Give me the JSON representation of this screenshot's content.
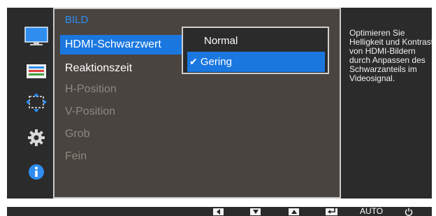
{
  "menu": {
    "title": "BILD",
    "items": [
      {
        "label": "HDMI-Schwarzwert",
        "state": "active"
      },
      {
        "label": "Reaktionszeit",
        "state": "normal"
      },
      {
        "label": "H-Position",
        "state": "disabled"
      },
      {
        "label": "V-Position",
        "state": "disabled"
      },
      {
        "label": "Grob",
        "state": "disabled"
      },
      {
        "label": "Fein",
        "state": "disabled"
      }
    ]
  },
  "submenu": {
    "options": [
      {
        "label": "Normal",
        "selected": false
      },
      {
        "label": "Gering",
        "selected": true
      }
    ],
    "check_glyph": "✔"
  },
  "description": "Optimieren Sie\nHelligkeit und Kontrast\nvon HDMI-Bildern\ndurch Anpassen des\nSchwarzanteils im\nVideosignal.",
  "side_icons": [
    "picture-icon",
    "color-icon",
    "size-position-icon",
    "setup-gear-icon",
    "information-icon"
  ],
  "bottom_keys": [
    {
      "name": "left-key",
      "glyph": "◀"
    },
    {
      "name": "down-key",
      "glyph": "▼"
    },
    {
      "name": "up-key",
      "glyph": "▲"
    },
    {
      "name": "enter-key",
      "glyph": "↵"
    },
    {
      "name": "auto-key",
      "label": "AUTO"
    },
    {
      "name": "power-key",
      "glyph": "⏻"
    }
  ],
  "colors": {
    "accent": "#1a77e0",
    "title": "#2a8ef0",
    "panel": "#4a4440",
    "background": "#2b2b2b"
  }
}
